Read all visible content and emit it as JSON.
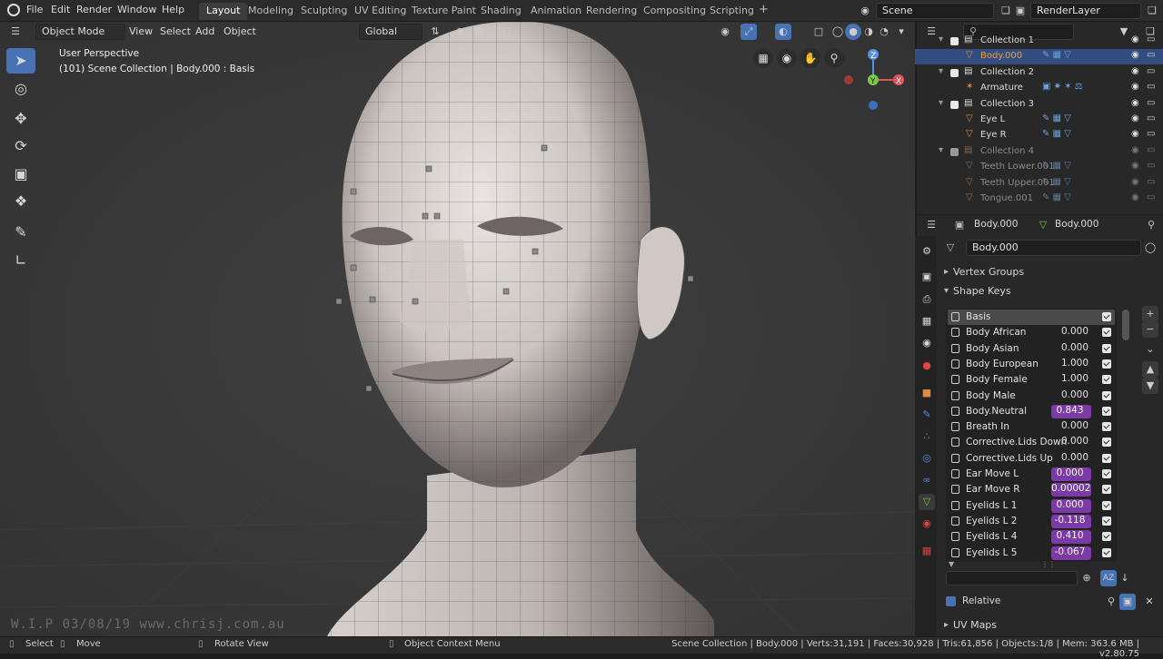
{
  "topbar": {
    "menus": [
      "File",
      "Edit",
      "Render",
      "Window",
      "Help"
    ],
    "workspaces": [
      "Layout",
      "Modeling",
      "Sculpting",
      "UV Editing",
      "Texture Paint",
      "Shading",
      "Animation",
      "Rendering",
      "Compositing",
      "Scripting"
    ],
    "add_tab": "+",
    "scene": "Scene",
    "view_layer": "RenderLayer"
  },
  "viewport": {
    "mode": "Object Mode",
    "menus": [
      "View",
      "Select",
      "Add",
      "Object"
    ],
    "orientation": "Global",
    "perspective_label": "User Perspective",
    "context_label": "(101) Scene Collection | Body.000 : Basis",
    "watermark": "W.I.P  03/08/19  www.chrisj.com.au",
    "gizmo": {
      "z": "Z",
      "x": "X",
      "y": "Y"
    }
  },
  "outliner": {
    "search_placeholder": "",
    "rows": [
      {
        "label": "Collection 1",
        "type": "collection",
        "indent": 0,
        "dim": false
      },
      {
        "label": "Body.000",
        "type": "mesh",
        "indent": 1,
        "dim": false,
        "selected": true
      },
      {
        "label": "Collection 2",
        "type": "collection",
        "indent": 0,
        "dim": false
      },
      {
        "label": "Armature",
        "type": "armature",
        "indent": 1,
        "dim": false
      },
      {
        "label": "Collection 3",
        "type": "collection",
        "indent": 0,
        "dim": false
      },
      {
        "label": "Eye L",
        "type": "mesh",
        "indent": 1,
        "dim": false
      },
      {
        "label": "Eye R",
        "type": "mesh",
        "indent": 1,
        "dim": false
      },
      {
        "label": "Collection 4",
        "type": "collection",
        "indent": 0,
        "dim": true
      },
      {
        "label": "Teeth Lower.001",
        "type": "mesh",
        "indent": 1,
        "dim": true
      },
      {
        "label": "Teeth Upper.001",
        "type": "mesh",
        "indent": 1,
        "dim": true
      },
      {
        "label": "Tongue.001",
        "type": "mesh",
        "indent": 1,
        "dim": true
      }
    ]
  },
  "properties": {
    "breadcrumb_object": "Body.000",
    "breadcrumb_data": "Body.000",
    "data_name": "Body.000",
    "panels": {
      "vertex_groups": "Vertex Groups",
      "shape_keys": "Shape Keys",
      "uv_maps": "UV Maps"
    },
    "relative_label": "Relative",
    "shape_keys": [
      {
        "name": "Basis",
        "value": "",
        "highlight": false,
        "active": true
      },
      {
        "name": "Body African",
        "value": "0.000",
        "highlight": false
      },
      {
        "name": "Body Asian",
        "value": "0.000",
        "highlight": false
      },
      {
        "name": "Body European",
        "value": "1.000",
        "highlight": false
      },
      {
        "name": "Body Female",
        "value": "1.000",
        "highlight": false
      },
      {
        "name": "Body Male",
        "value": "0.000",
        "highlight": false
      },
      {
        "name": "Body.Neutral",
        "value": "0.843",
        "highlight": true
      },
      {
        "name": "Breath In",
        "value": "0.000",
        "highlight": false
      },
      {
        "name": "Corrective.Lids Down",
        "value": "0.000",
        "highlight": false
      },
      {
        "name": "Corrective.Lids Up",
        "value": "0.000",
        "highlight": false
      },
      {
        "name": "Ear Move L",
        "value": "0.000",
        "highlight": true
      },
      {
        "name": "Ear Move R",
        "value": "0.00002",
        "highlight": true
      },
      {
        "name": "Eyelids L 1",
        "value": "0.000",
        "highlight": true
      },
      {
        "name": "Eyelids L 2",
        "value": "-0.118",
        "highlight": true
      },
      {
        "name": "Eyelids L 4",
        "value": "0.410",
        "highlight": true
      },
      {
        "name": "Eyelids L 5",
        "value": "-0.067",
        "highlight": true
      }
    ]
  },
  "statusbar": {
    "select": "Select",
    "move": "Move",
    "rotate": "Rotate View",
    "context_menu": "Object Context Menu",
    "stats": "Scene Collection | Body.000 | Verts:31,191 | Faces:30,928 | Tris:61,856 | Objects:1/8 | Mem: 363.6 MB | v2.80.75"
  },
  "colors": {
    "accent": "#4772b3",
    "highlight_value": "#7b3aa8",
    "mesh_icon": "#e08a3c",
    "viewport_bg": "#393939"
  }
}
